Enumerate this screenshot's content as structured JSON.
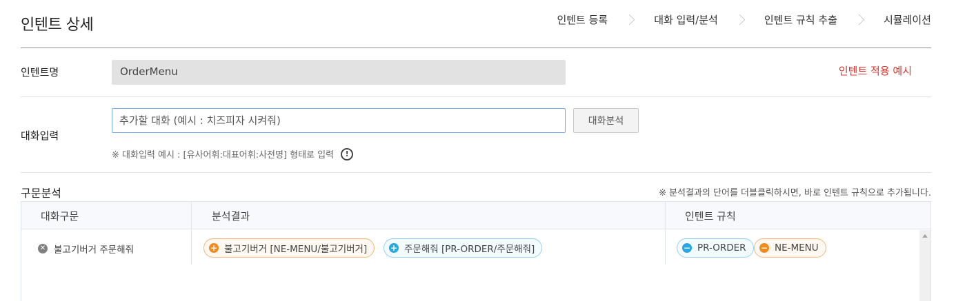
{
  "header": {
    "title": "인텐트 상세",
    "steps": [
      "인텐트 등록",
      "대화 입력/분석",
      "인텐트 규칙 추출",
      "시뮬레이션"
    ]
  },
  "intent_name": {
    "label": "인텐트명",
    "value": "OrderMenu",
    "example_link": "인텐트 적용 예시"
  },
  "chat_input": {
    "label": "대화입력",
    "placeholder": "추가할 대화 (예시 : 치즈피자 시켜줘)",
    "button": "대화분석",
    "hint": "※ 대화입력 예시 : [유사어휘:대표어휘:사전명] 형태로 입력"
  },
  "analysis": {
    "title": "구문분석",
    "note": "※ 분석결과의 단어를 더블클릭하시면, 바로 인텐트 규칙으로 추가됩니다.",
    "columns": [
      "대화구문",
      "분석결과",
      "인텐트 규칙"
    ],
    "rows": [
      {
        "phrase": "불고기버거 주문해줘",
        "results": [
          {
            "icon": "plus-icon",
            "text": "불고기버거 [NE-MENU/불고기버거]",
            "color": "#f08a1d"
          },
          {
            "icon": "plus-icon",
            "text": "주문해줘 [PR-ORDER/주문해줘]",
            "color": "#2aa6e3"
          }
        ],
        "rules": [
          {
            "icon": "minus-icon",
            "text": "PR-ORDER",
            "color": "#2aa6e3"
          },
          {
            "icon": "minus-icon",
            "text": "NE-MENU",
            "color": "#f08a1d"
          }
        ]
      }
    ]
  },
  "colors": {
    "accent_red": "#d9362f",
    "input_border": "#79a8e8",
    "orange": "#f08a1d",
    "blue": "#2aa6e3"
  }
}
